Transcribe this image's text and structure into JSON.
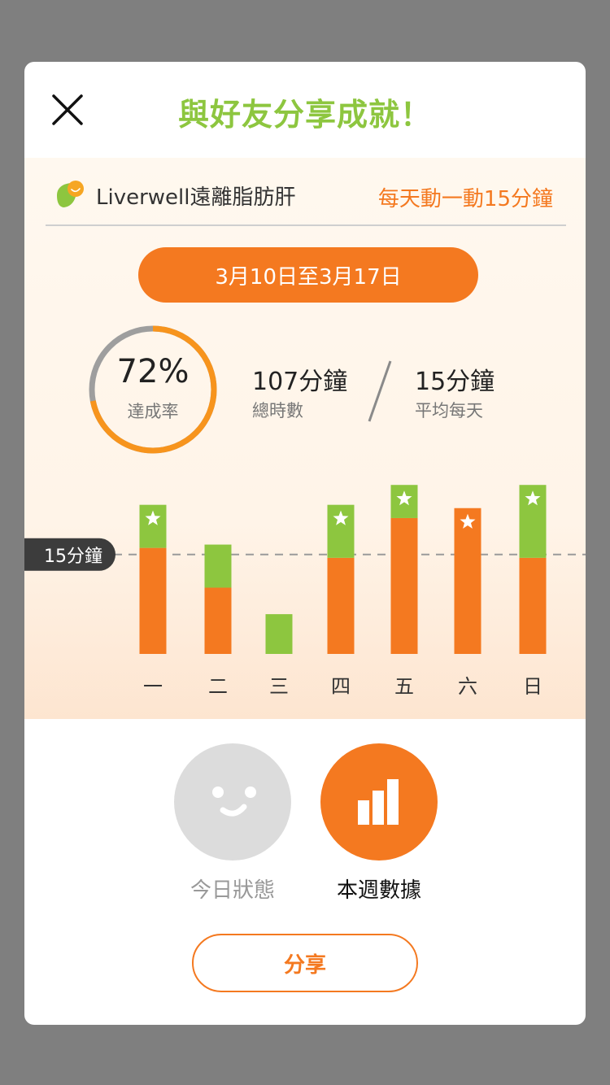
{
  "header": {
    "title": "與好友分享成就！",
    "close_icon": "close-icon"
  },
  "card": {
    "brand_name": "Liverwell遠離脂肪肝",
    "brand_icon": "leaf-logo-icon",
    "plan_label": "每天動一動15分鐘",
    "date_range": "3月10日至3月17日",
    "completion": {
      "value": "72%",
      "label": "達成率",
      "fraction": 0.72
    },
    "total": {
      "value": "107分鐘",
      "label": "總時數"
    },
    "average": {
      "value": "15分鐘",
      "label": "平均每天"
    }
  },
  "chart_data": {
    "type": "bar",
    "categories": [
      "一",
      "二",
      "三",
      "四",
      "五",
      "六",
      "日"
    ],
    "series": [
      {
        "values": [
          16,
          10,
          0,
          14.5,
          20.5,
          22,
          14.5
        ]
      },
      {
        "values": [
          6.5,
          6.5,
          6,
          8,
          5,
          0,
          11
        ]
      }
    ],
    "target": {
      "label": "15分鐘",
      "value": 15
    },
    "star_days": [
      "一",
      "四",
      "五",
      "六",
      "日"
    ],
    "ylim": [
      0,
      27
    ],
    "colors": {
      "orange": "#f47920",
      "green": "#8dc63f"
    }
  },
  "tabs": [
    {
      "label": "今日狀態",
      "icon": "smiley-face-icon",
      "active": false
    },
    {
      "label": "本週數據",
      "icon": "bar-chart-icon",
      "active": true
    }
  ],
  "share_label": "分享",
  "colors": {
    "accent": "#f47920",
    "green": "#8dc63f",
    "inactive": "#dcdcdc"
  }
}
